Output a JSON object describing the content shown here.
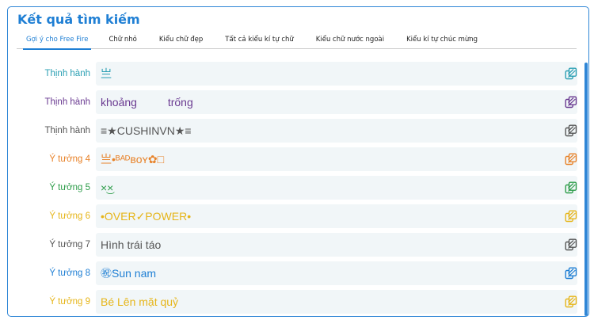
{
  "header": {
    "title": "Kết quả tìm kiếm"
  },
  "tabs": [
    {
      "label": "Gợi ý cho Free Fire",
      "active": true
    },
    {
      "label": "Chữ nhỏ",
      "active": false
    },
    {
      "label": "Kiểu chữ đẹp",
      "active": false
    },
    {
      "label": "Tất cả kiểu kí tự chữ",
      "active": false
    },
    {
      "label": "Kiểu chữ nước ngoài",
      "active": false
    },
    {
      "label": "Kiểu kí tự chúc mừng",
      "active": false
    }
  ],
  "results": [
    {
      "label": "Thịnh hành",
      "text": "亗",
      "color": "#2a9fb3"
    },
    {
      "label": "Thịnh hành",
      "text": "khoảng          trống",
      "color": "#6a3a91"
    },
    {
      "label": "Thịnh hành",
      "text": "≡★CUSHINVN★≡",
      "color": "#555555"
    },
    {
      "label": "Ý tưởng 4",
      "text": "亗•ᴮᴬᴰʙᴏʏ✿□",
      "color": "#e8832a"
    },
    {
      "label": "Ý tưởng 5",
      "text": "×͜×",
      "color": "#2e9d4a"
    },
    {
      "label": "Ý tưởng 6",
      "text": "•OVER✓POWER•",
      "color": "#e6b519"
    },
    {
      "label": "Ý tưởng 7",
      "text": "Hình trái táo",
      "color": "#555555"
    },
    {
      "label": "Ý tưởng 8",
      "text": "㊗Sun nam",
      "color": "#1f7fd4"
    },
    {
      "label": "Ý tưởng 9",
      "text": "Bé Lên mặt quỷ",
      "color": "#e6b519"
    }
  ],
  "icons": {
    "copy": "copy-icon"
  }
}
